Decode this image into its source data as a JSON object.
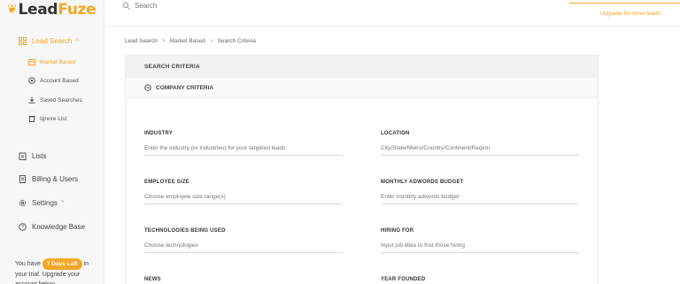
{
  "app": {
    "logo_prefix": "Lead",
    "logo_suffix": "Fuze",
    "accent_color": "#f5a623"
  },
  "topbar": {
    "search_placeholder": "Search",
    "upgrade_label": "Upgrade for more leads"
  },
  "sidebar": {
    "main": [
      {
        "label": "Lead Search",
        "icon": "grid-icon",
        "active": true,
        "expandable": true
      },
      {
        "label": "Lists",
        "icon": "clipboard-icon"
      },
      {
        "label": "Billing & Users",
        "icon": "receipt-icon"
      },
      {
        "label": "Settings",
        "icon": "gear-icon",
        "expandable": true
      },
      {
        "label": "Knowledge Base",
        "icon": "question-circle-icon"
      }
    ],
    "sub": [
      {
        "label": "Market Based",
        "icon": "building-icon",
        "active": true
      },
      {
        "label": "Account Based",
        "icon": "target-icon"
      },
      {
        "label": "Saved Searches",
        "icon": "download-icon"
      },
      {
        "label": "Ignore List",
        "icon": "trash-icon"
      }
    ],
    "trial": {
      "prefix": "You have",
      "badge": "7 Days Left",
      "suffix": "in your trial. Upgrade your account below"
    }
  },
  "breadcrumb": [
    "Lead Search",
    "Market Based",
    "Search Criteria"
  ],
  "card": {
    "title": "SEARCH CRITERIA",
    "section": "COMPANY CRITERIA",
    "fields": [
      {
        "label": "INDUSTRY",
        "placeholder": "Enter the industry (or industries) for your targeted leads"
      },
      {
        "label": "LOCATION",
        "placeholder": "City/State/Metro/Country/Continent/Region"
      },
      {
        "label": "EMPLOYEE SIZE",
        "placeholder": "Choose employee size range(s)"
      },
      {
        "label": "MONTHLY ADWORDS BUDGET",
        "placeholder": "Enter monthly adwords budget"
      },
      {
        "label": "TECHNOLOGIES BEING USED",
        "placeholder": "Choose technologies"
      },
      {
        "label": "HIRING FOR",
        "placeholder": "Input job titles to find those hiring"
      },
      {
        "label": "NEWS",
        "placeholder": ""
      },
      {
        "label": "YEAR FOUNDED",
        "placeholder": ""
      }
    ]
  }
}
